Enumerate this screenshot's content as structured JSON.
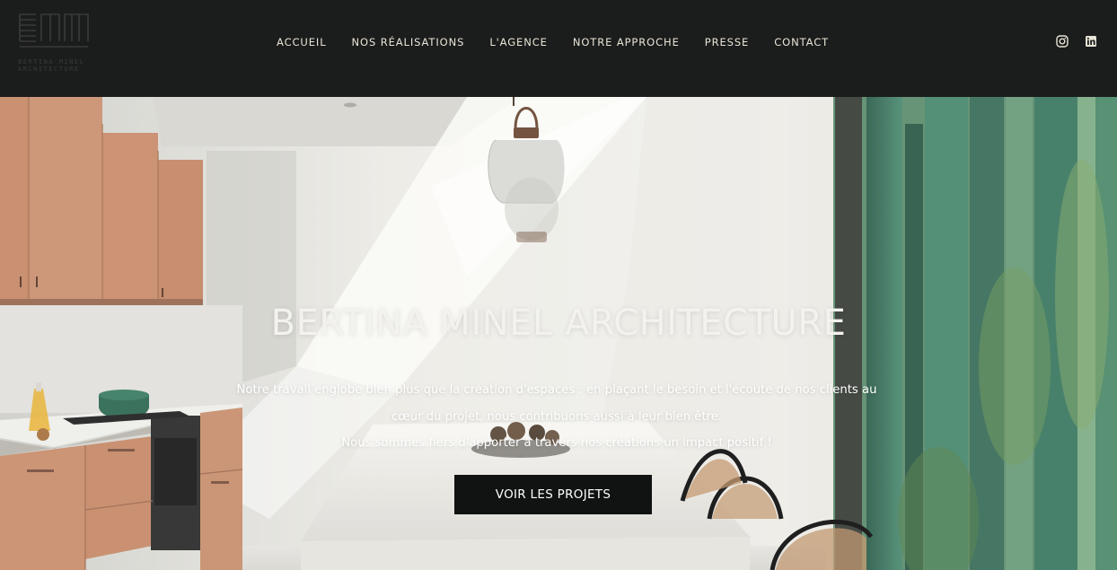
{
  "header": {
    "logo_text": "BERTINA MINEL ARCHITECTURE",
    "nav": [
      {
        "label": "ACCUEIL"
      },
      {
        "label": "NOS RÉALISATIONS"
      },
      {
        "label": "L'AGENCE"
      },
      {
        "label": "NOTRE APPROCHE"
      },
      {
        "label": "PRESSE"
      },
      {
        "label": "CONTACT"
      }
    ],
    "social": [
      "instagram-icon",
      "linkedin-icon"
    ]
  },
  "hero": {
    "title": "BERTINA MINEL ARCHITECTURE",
    "text_lines": [
      "Notre travail englobe bien plus que la création d'espaces : en plaçant le besoin et l'écoute de nos clients au",
      "cœur du projet, nous contribuons aussi à leur bien être.",
      "Nous sommes fiers d'apporter à travers nos créations un impact positif !"
    ],
    "cta_label": "VOIR LES PROJETS"
  },
  "colors": {
    "header_bg": "#1b1c1c",
    "nav_text": "#e8e4d6",
    "cta_bg": "#111212",
    "cabinet": "#c98f6e",
    "window_green": "#3f7d66"
  }
}
